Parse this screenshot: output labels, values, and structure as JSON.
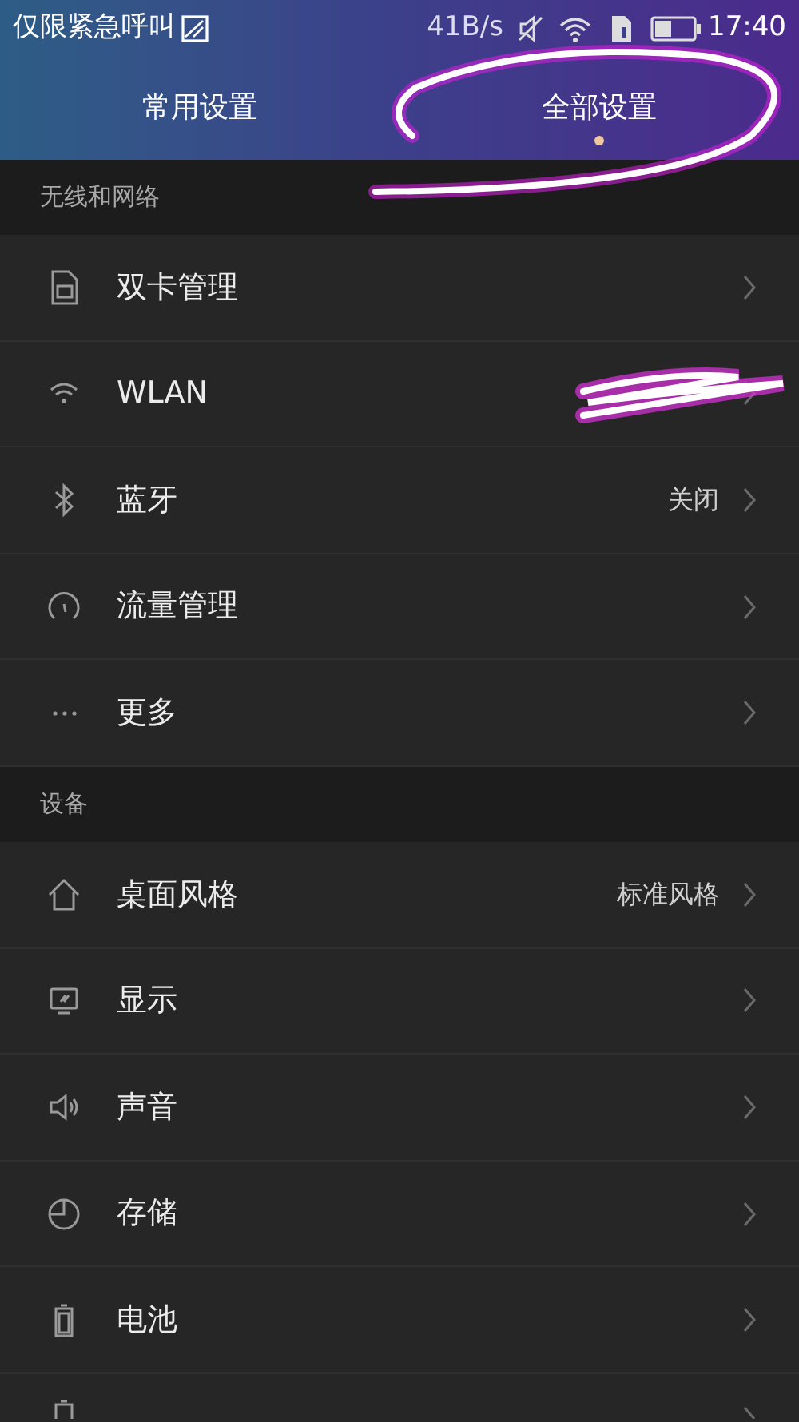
{
  "status_bar": {
    "carrier": "仅限紧急呼叫",
    "speed": "41B/s",
    "time": "17:40"
  },
  "tabs": [
    {
      "label": "常用设置",
      "selected": false
    },
    {
      "label": "全部设置",
      "selected": true
    }
  ],
  "sections": [
    {
      "title": "无线和网络",
      "items": [
        {
          "label": "双卡管理"
        },
        {
          "label": "WLAN"
        },
        {
          "label": "蓝牙",
          "value": "关闭"
        },
        {
          "label": "流量管理"
        },
        {
          "label": "更多"
        }
      ]
    },
    {
      "title": "设备",
      "items": [
        {
          "label": "桌面风格",
          "value": "标准风格"
        },
        {
          "label": "显示"
        },
        {
          "label": "声音"
        },
        {
          "label": "存储"
        },
        {
          "label": "电池"
        }
      ],
      "cut_off_row": true
    }
  ]
}
